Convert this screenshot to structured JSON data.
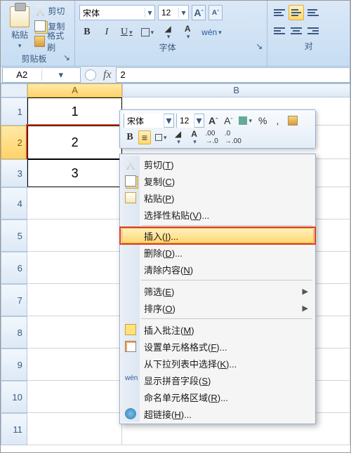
{
  "ribbon": {
    "clipboard": {
      "title": "剪贴板",
      "paste": "粘贴",
      "cut": "剪切",
      "copy": "复制",
      "format_painter": "格式刷"
    },
    "font": {
      "title": "字体",
      "name": "宋体",
      "size": "12",
      "grow": "A",
      "shrink": "A",
      "bold": "B",
      "italic": "I",
      "underline": "U",
      "fontcolor_bar": "#d22",
      "fillcolor_bar": "#ffd400",
      "wen": "wén"
    },
    "align": {
      "title": "对"
    }
  },
  "formula_bar": {
    "name": "A2",
    "fx": "fx",
    "value": "2"
  },
  "columns": [
    "A",
    "B"
  ],
  "row_headers": [
    "1",
    "2",
    "3",
    "4",
    "5",
    "6",
    "7",
    "8",
    "9",
    "10",
    "11"
  ],
  "cells": {
    "A1": "1",
    "A2": "2",
    "A3": "3"
  },
  "minitoolbar": {
    "fontname": "宋体",
    "fontsize": "12",
    "grow": "A",
    "shrink": "A",
    "currency": "%",
    "bold": "B",
    "fontcolor_bar": "#d22"
  },
  "context_menu": {
    "cut": "剪切(T)",
    "copy": "复制(C)",
    "paste": "粘贴(P)",
    "paste_special": "选择性粘贴(V)...",
    "insert": "插入(I)...",
    "delete": "删除(D)...",
    "clear": "清除内容(N)",
    "filter": "筛选(E)",
    "sort": "排序(O)",
    "comment": "插入批注(M)",
    "format_cells": "设置单元格格式(F)...",
    "dropdown": "从下拉列表中选择(K)...",
    "phonetic": "显示拼音字段(S)",
    "name_range": "命名单元格区域(R)...",
    "hyperlink": "超链接(H)..."
  },
  "colors": {
    "accent": "#3b5a82"
  }
}
